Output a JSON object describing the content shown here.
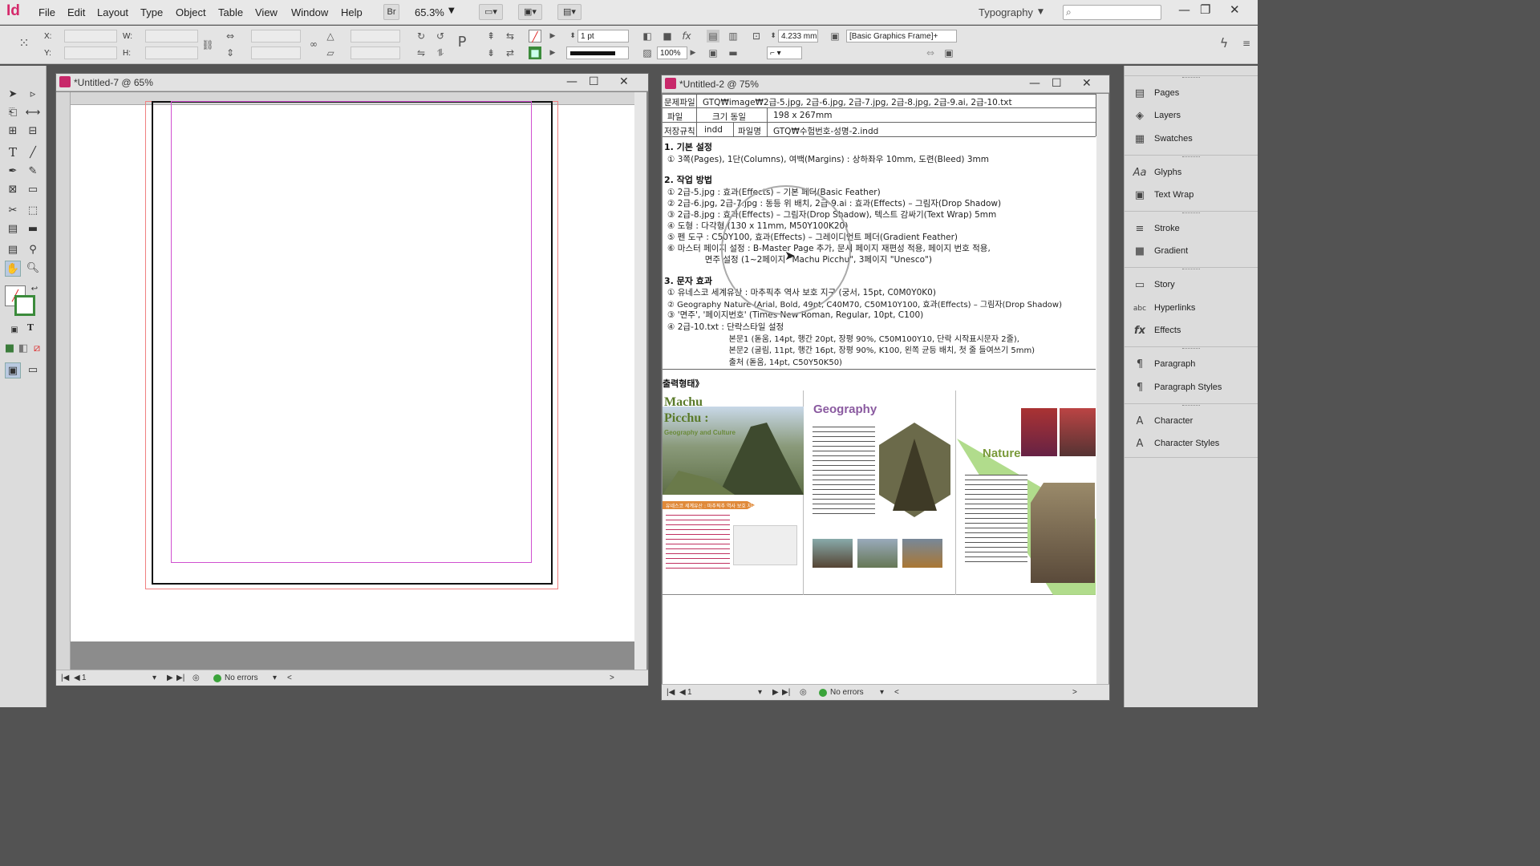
{
  "app": {
    "logo": "Id",
    "zoom": "65.3%",
    "workspace": "Typography",
    "bridge_label": "Br"
  },
  "menu": [
    "File",
    "Edit",
    "Layout",
    "Type",
    "Object",
    "Table",
    "View",
    "Window",
    "Help"
  ],
  "control_panel": {
    "x_label": "X:",
    "y_label": "Y:",
    "w_label": "W:",
    "h_label": "H:",
    "stroke_weight": "1 pt",
    "opacity": "100%",
    "dimension": "4.233 mm",
    "object_style": "[Basic Graphics Frame]+"
  },
  "doc1": {
    "title": "*Untitled-7 @ 65%",
    "page": "1",
    "status": "No errors"
  },
  "doc2": {
    "title": "*Untitled-2 @ 75%",
    "page": "1",
    "status": "No errors",
    "table": {
      "r1_label": "문제파일",
      "r1_value": "GTQ₩image₩2급-5.jpg, 2급-6.jpg, 2급-7.jpg, 2급-8.jpg, 2급-9.ai, 2급-10.txt",
      "r2_label": "파일",
      "r2_sub": "크기 동일",
      "r2_value": "198 x 267mm",
      "r3_label": "저장규칙",
      "r3_sub1": "indd",
      "r3_sub2": "파일명",
      "r3_value": "GTQ₩수험번호-성명-2.indd"
    },
    "sections": [
      {
        "head": "1. 기본 설정",
        "lines": [
          "① 3쪽(Pages), 1단(Columns), 여백(Margins) : 상하좌우 10mm, 도련(Bleed) 3mm"
        ]
      },
      {
        "head": "2. 작업 방법",
        "lines": [
          "① 2급-5.jpg : 효과(Effects) – 기본 페더(Basic Feather)",
          "② 2급-6.jpg, 2급-7.jpg : 동등 위 배치, 2급-9.ai : 효과(Effects) – 그림자(Drop Shadow)",
          "③ 2급-8.jpg : 효과(Effects) – 그림자(Drop Shadow), 텍스트 감싸기(Text Wrap) 5mm",
          "④ 도형 : 다각형 (130 x 11mm, M50Y100K20)",
          "⑤ 펜 도구 : C50Y100, 효과(Effects) – 그레이디언트 페더(Gradient Feather)",
          "⑥ 마스터 페이지 설정 : B-Master Page 추가, 문서 페이지 재편성 적용, 페이지 번호 적용,",
          "              면주 설정 (1~2페이지 \"Machu Picchu\", 3페이지 \"Unesco\")"
        ]
      },
      {
        "head": "3. 문자 효과",
        "lines": [
          "① 유네스코 세계유산 : 마추픽추 역사 보호 지구 (궁서, 15pt, C0M0Y0K0)",
          "② Geography  Nature (Arial, Bold, 49pt, C40M70, C50M10Y100, 효과(Effects) – 그림자(Drop Shadow)",
          "③ '면주', '페이지번호' (Times New Roman, Regular, 10pt, C100)",
          "④ 2급-10.txt : 단락스타일 설정",
          "                          본문1 (돋움, 14pt, 행간 20pt, 장평 90%, C50M100Y10, 단락 시작표시문자 2줄),",
          "                          본문2 (굴림, 11pt, 행간 16pt, 장평 90%, K100, 왼쪽 균등 배치, 첫 줄 들여쓰기 5mm)",
          "                          출처 (돋움, 14pt, C50Y50K50)"
        ]
      }
    ],
    "output_label": "출력형태》",
    "preview": {
      "title1_a": "Machu",
      "title1_b": "Picchu :",
      "title1_sub": "Geography and Culture",
      "title2": "Geography",
      "title3": "Nature",
      "banner": "유네스코 세계유산 : 마추픽추 역사 보호 지구"
    }
  },
  "panels": [
    {
      "label": "Pages",
      "icon": "pages-icon",
      "glyph": "▤"
    },
    {
      "label": "Layers",
      "icon": "layers-icon",
      "glyph": "◈"
    },
    {
      "label": "Swatches",
      "icon": "swatches-icon",
      "glyph": "▦"
    },
    {
      "label": "Glyphs",
      "icon": "glyphs-icon",
      "glyph": "Aa"
    },
    {
      "label": "Text Wrap",
      "icon": "text-wrap-icon",
      "glyph": "▣"
    },
    {
      "label": "Stroke",
      "icon": "stroke-icon",
      "glyph": "≡"
    },
    {
      "label": "Gradient",
      "icon": "gradient-icon",
      "glyph": "■"
    },
    {
      "label": "Story",
      "icon": "story-icon",
      "glyph": "▭"
    },
    {
      "label": "Hyperlinks",
      "icon": "hyperlinks-icon",
      "glyph": "abc"
    },
    {
      "label": "Effects",
      "icon": "effects-icon",
      "glyph": "fx"
    },
    {
      "label": "Paragraph",
      "icon": "paragraph-icon",
      "glyph": "¶"
    },
    {
      "label": "Paragraph Styles",
      "icon": "paragraph-styles-icon",
      "glyph": "¶"
    },
    {
      "label": "Character",
      "icon": "character-icon",
      "glyph": "A"
    },
    {
      "label": "Character Styles",
      "icon": "character-styles-icon",
      "glyph": "A"
    }
  ]
}
